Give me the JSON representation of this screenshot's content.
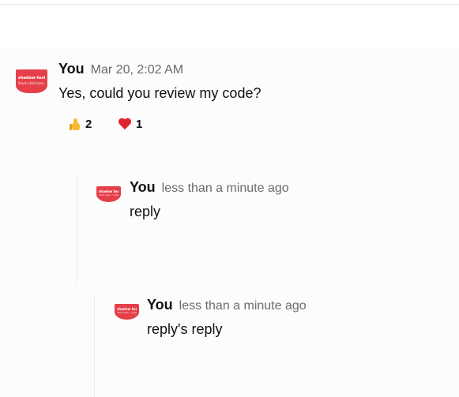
{
  "messages": [
    {
      "author": "You",
      "timestamp": "Mar 20, 2:02 AM",
      "text": "Yes, could you review my code?",
      "avatar": {
        "line1": "shadow‑texts",
        "line2": "Stack‑child area · 2023"
      },
      "reactions": [
        {
          "emoji": "thumbs-up-icon",
          "count": "2"
        },
        {
          "emoji": "heart-icon",
          "count": "1"
        }
      ]
    },
    {
      "author": "You",
      "timestamp": "less than a minute ago",
      "text": "reply",
      "avatar": {
        "line1": "shadow texts",
        "line2": "child area · code"
      }
    },
    {
      "author": "You",
      "timestamp": "less than a minute ago",
      "text": "reply's reply",
      "avatar": {
        "line1": "shadow texts",
        "line2": "child area · code"
      }
    }
  ],
  "colors": {
    "avatar": "#e5404a",
    "author": "#111111",
    "timestamp": "#6b6b6b",
    "thread_background": "#fcfcfc",
    "heart": "#e0242e",
    "thumbs": "#f5b932"
  }
}
